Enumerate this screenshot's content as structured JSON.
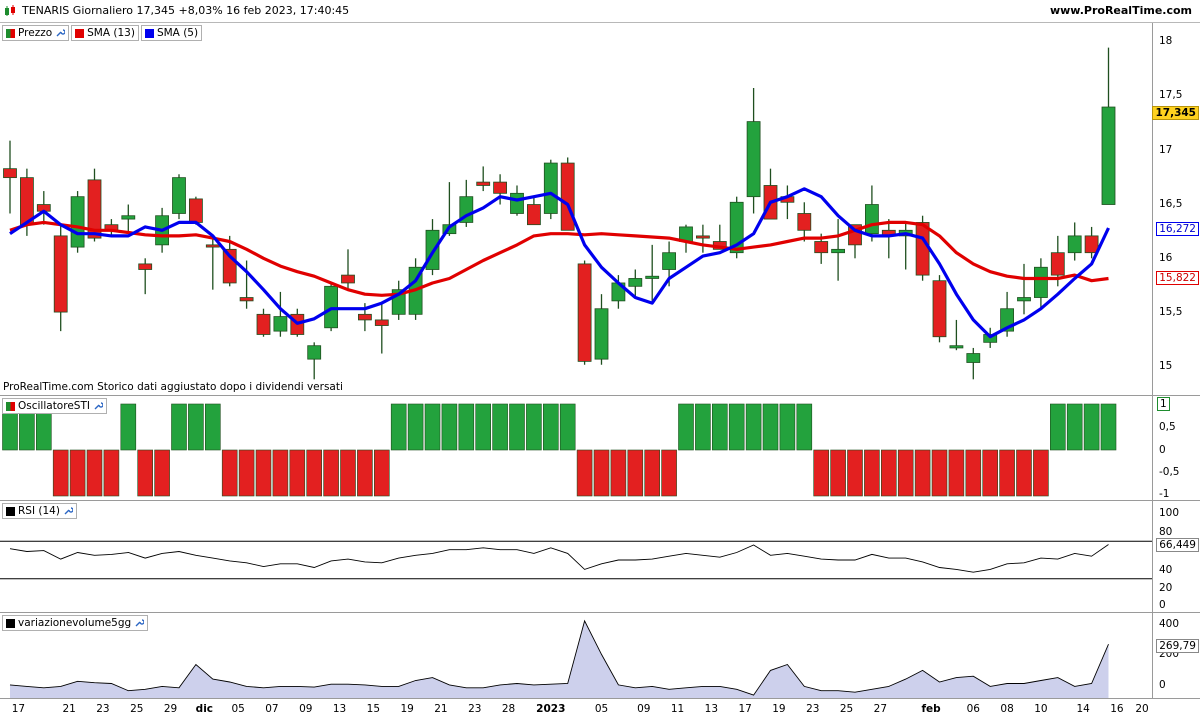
{
  "header": {
    "title": "TENARIS Giornaliero 17,345 +8,03% 16 feb 2023, 17:40:45",
    "site": "www.ProRealTime.com"
  },
  "price_panel": {
    "legend": [
      {
        "label": "Prezzo",
        "color": "#1e8c2e"
      },
      {
        "label": "SMA (13)",
        "color": "#e00000"
      },
      {
        "label": "SMA (5)",
        "color": "#0000ee"
      }
    ],
    "y_ticks": [
      "18",
      "17,5",
      "17",
      "16,5",
      "16",
      "15,5",
      "15"
    ],
    "last_price_badge": "17,345",
    "sma5_badge": "16,272",
    "sma13_badge": "15,822",
    "footnote": "ProRealTime.com  Storico dati aggiustato dopo i dividendi versati"
  },
  "sti_panel": {
    "legend_label": "OscillatoreSTI",
    "y_ticks": [
      "0,5",
      "0",
      "-0,5",
      "-1"
    ],
    "value_badge": "1"
  },
  "rsi_panel": {
    "legend_label": "RSI (14)",
    "y_ticks": [
      "100",
      "80",
      "40",
      "20",
      "0"
    ],
    "value_badge": "66,449"
  },
  "vol_panel": {
    "legend_label": "variazionevolume5gg",
    "y_ticks": [
      "400",
      "200",
      "0"
    ],
    "value_badge": "269,79"
  },
  "x_labels": [
    "17",
    "21",
    "23",
    "25",
    "29",
    "dic",
    "05",
    "07",
    "09",
    "13",
    "15",
    "19",
    "21",
    "23",
    "28",
    "2023",
    "05",
    "09",
    "11",
    "13",
    "17",
    "19",
    "23",
    "25",
    "27",
    "feb",
    "06",
    "08",
    "10",
    "14",
    "16",
    "20"
  ],
  "chart_data": {
    "type": "candlestick",
    "title": "TENARIS Giornaliero",
    "ohlc": [
      {
        "o": 16.8,
        "h": 17.05,
        "l": 16.4,
        "c": 16.72
      },
      {
        "o": 16.72,
        "h": 16.8,
        "l": 16.2,
        "c": 16.3
      },
      {
        "o": 16.48,
        "h": 16.6,
        "l": 16.3,
        "c": 16.42
      },
      {
        "o": 16.2,
        "h": 16.3,
        "l": 15.35,
        "c": 15.52
      },
      {
        "o": 16.1,
        "h": 16.6,
        "l": 16.05,
        "c": 16.55
      },
      {
        "o": 16.7,
        "h": 16.8,
        "l": 16.15,
        "c": 16.18
      },
      {
        "o": 16.3,
        "h": 16.35,
        "l": 16.2,
        "c": 16.25
      },
      {
        "o": 16.35,
        "h": 16.48,
        "l": 16.22,
        "c": 16.38
      },
      {
        "o": 15.95,
        "h": 16.0,
        "l": 15.68,
        "c": 15.9
      },
      {
        "o": 16.12,
        "h": 16.45,
        "l": 16.05,
        "c": 16.38
      },
      {
        "o": 16.4,
        "h": 16.75,
        "l": 16.35,
        "c": 16.72
      },
      {
        "o": 16.53,
        "h": 16.55,
        "l": 16.3,
        "c": 16.32
      },
      {
        "o": 16.12,
        "h": 16.2,
        "l": 15.72,
        "c": 16.1
      },
      {
        "o": 16.08,
        "h": 16.2,
        "l": 15.75,
        "c": 15.78
      },
      {
        "o": 15.65,
        "h": 15.98,
        "l": 15.55,
        "c": 15.62
      },
      {
        "o": 15.5,
        "h": 15.55,
        "l": 15.3,
        "c": 15.32
      },
      {
        "o": 15.35,
        "h": 15.7,
        "l": 15.3,
        "c": 15.48
      },
      {
        "o": 15.5,
        "h": 15.55,
        "l": 15.3,
        "c": 15.32
      },
      {
        "o": 15.1,
        "h": 15.25,
        "l": 14.92,
        "c": 15.22
      },
      {
        "o": 15.38,
        "h": 15.78,
        "l": 15.35,
        "c": 15.75
      },
      {
        "o": 15.85,
        "h": 16.08,
        "l": 15.72,
        "c": 15.78
      },
      {
        "o": 15.5,
        "h": 15.6,
        "l": 15.35,
        "c": 15.45
      },
      {
        "o": 15.45,
        "h": 15.6,
        "l": 15.15,
        "c": 15.4
      },
      {
        "o": 15.5,
        "h": 15.8,
        "l": 15.45,
        "c": 15.72
      },
      {
        "o": 15.5,
        "h": 16.0,
        "l": 15.45,
        "c": 15.92
      },
      {
        "o": 15.9,
        "h": 16.35,
        "l": 15.85,
        "c": 16.25
      },
      {
        "o": 16.22,
        "h": 16.68,
        "l": 16.2,
        "c": 16.3
      },
      {
        "o": 16.32,
        "h": 16.7,
        "l": 16.28,
        "c": 16.55
      },
      {
        "o": 16.68,
        "h": 16.82,
        "l": 16.6,
        "c": 16.65
      },
      {
        "o": 16.68,
        "h": 16.75,
        "l": 16.48,
        "c": 16.58
      },
      {
        "o": 16.4,
        "h": 16.65,
        "l": 16.38,
        "c": 16.58
      },
      {
        "o": 16.48,
        "h": 16.55,
        "l": 16.3,
        "c": 16.3
      },
      {
        "o": 16.4,
        "h": 16.88,
        "l": 16.35,
        "c": 16.85
      },
      {
        "o": 16.85,
        "h": 16.9,
        "l": 16.25,
        "c": 16.25
      },
      {
        "o": 15.95,
        "h": 15.98,
        "l": 15.05,
        "c": 15.08
      },
      {
        "o": 15.1,
        "h": 15.68,
        "l": 15.05,
        "c": 15.55
      },
      {
        "o": 15.62,
        "h": 15.85,
        "l": 15.55,
        "c": 15.78
      },
      {
        "o": 15.75,
        "h": 15.9,
        "l": 15.65,
        "c": 15.82
      },
      {
        "o": 15.82,
        "h": 16.12,
        "l": 15.62,
        "c": 15.84
      },
      {
        "o": 15.9,
        "h": 16.15,
        "l": 15.75,
        "c": 16.05
      },
      {
        "o": 16.15,
        "h": 16.3,
        "l": 16.05,
        "c": 16.28
      },
      {
        "o": 16.2,
        "h": 16.3,
        "l": 16.05,
        "c": 16.18
      },
      {
        "o": 16.15,
        "h": 16.3,
        "l": 16.08,
        "c": 16.08
      },
      {
        "o": 16.05,
        "h": 16.55,
        "l": 16.0,
        "c": 16.5
      },
      {
        "o": 16.55,
        "h": 17.52,
        "l": 16.4,
        "c": 17.22
      },
      {
        "o": 16.65,
        "h": 16.8,
        "l": 16.35,
        "c": 16.35
      },
      {
        "o": 16.55,
        "h": 16.65,
        "l": 16.35,
        "c": 16.5
      },
      {
        "o": 16.4,
        "h": 16.5,
        "l": 16.15,
        "c": 16.25
      },
      {
        "o": 16.15,
        "h": 16.22,
        "l": 15.95,
        "c": 16.05
      },
      {
        "o": 16.05,
        "h": 16.35,
        "l": 15.8,
        "c": 16.08
      },
      {
        "o": 16.3,
        "h": 16.3,
        "l": 16.0,
        "c": 16.12
      },
      {
        "o": 16.22,
        "h": 16.65,
        "l": 16.15,
        "c": 16.48
      },
      {
        "o": 16.25,
        "h": 16.35,
        "l": 16.0,
        "c": 16.2
      },
      {
        "o": 16.2,
        "h": 16.32,
        "l": 15.9,
        "c": 16.25
      },
      {
        "o": 16.32,
        "h": 16.38,
        "l": 15.8,
        "c": 15.85
      },
      {
        "o": 15.8,
        "h": 15.85,
        "l": 15.25,
        "c": 15.3
      },
      {
        "o": 15.2,
        "h": 15.45,
        "l": 15.18,
        "c": 15.22
      },
      {
        "o": 15.07,
        "h": 15.2,
        "l": 14.92,
        "c": 15.15
      },
      {
        "o": 15.25,
        "h": 15.38,
        "l": 15.2,
        "c": 15.32
      },
      {
        "o": 15.35,
        "h": 15.7,
        "l": 15.3,
        "c": 15.55
      },
      {
        "o": 15.62,
        "h": 15.95,
        "l": 15.5,
        "c": 15.65
      },
      {
        "o": 15.65,
        "h": 16.0,
        "l": 15.55,
        "c": 15.92
      },
      {
        "o": 16.05,
        "h": 16.2,
        "l": 15.75,
        "c": 15.85
      },
      {
        "o": 16.05,
        "h": 16.32,
        "l": 15.98,
        "c": 16.2
      },
      {
        "o": 16.2,
        "h": 16.28,
        "l": 16.0,
        "c": 16.05
      },
      {
        "o": 16.48,
        "h": 17.88,
        "l": 16.48,
        "c": 17.35
      }
    ],
    "sma5": [
      16.22,
      16.32,
      16.42,
      16.3,
      16.22,
      16.22,
      16.2,
      16.2,
      16.28,
      16.25,
      16.32,
      16.32,
      16.2,
      16.02,
      15.88,
      15.72,
      15.55,
      15.42,
      15.46,
      15.55,
      15.55,
      15.55,
      15.6,
      15.68,
      15.8,
      16.05,
      16.28,
      16.38,
      16.45,
      16.55,
      16.52,
      16.55,
      16.58,
      16.48,
      16.12,
      15.92,
      15.78,
      15.65,
      15.6,
      15.82,
      15.92,
      16.02,
      16.05,
      16.12,
      16.22,
      16.5,
      16.55,
      16.62,
      16.55,
      16.38,
      16.25,
      16.2,
      16.2,
      16.22,
      16.18,
      15.95,
      15.68,
      15.45,
      15.3,
      15.38,
      15.45,
      15.55,
      15.68,
      15.82,
      15.95,
      16.27
    ],
    "sma13": [
      16.25,
      16.3,
      16.32,
      16.3,
      16.28,
      16.25,
      16.25,
      16.23,
      16.21,
      16.2,
      16.2,
      16.21,
      16.18,
      16.15,
      16.08,
      16.0,
      15.93,
      15.88,
      15.84,
      15.78,
      15.72,
      15.68,
      15.67,
      15.68,
      15.72,
      15.78,
      15.82,
      15.9,
      15.98,
      16.05,
      16.12,
      16.2,
      16.22,
      16.22,
      16.21,
      16.22,
      16.21,
      16.2,
      16.19,
      16.18,
      16.15,
      16.12,
      16.1,
      16.08,
      16.1,
      16.12,
      16.15,
      16.18,
      16.18,
      16.2,
      16.25,
      16.3,
      16.32,
      16.32,
      16.3,
      16.2,
      16.05,
      15.95,
      15.88,
      15.84,
      15.82,
      15.82,
      15.82,
      15.85,
      15.8,
      15.82
    ],
    "sti": [
      1,
      1,
      1,
      -1,
      -1,
      -1,
      -1,
      1,
      -1,
      -1,
      1,
      1,
      1,
      -1,
      -1,
      -1,
      -1,
      -1,
      -1,
      -1,
      -1,
      -1,
      -1,
      1,
      1,
      1,
      1,
      1,
      1,
      1,
      1,
      1,
      1,
      1,
      -1,
      -1,
      -1,
      -1,
      -1,
      -1,
      1,
      1,
      1,
      1,
      1,
      1,
      1,
      1,
      -1,
      -1,
      -1,
      -1,
      -1,
      -1,
      -1,
      -1,
      -1,
      -1,
      -1,
      -1,
      -1,
      -1,
      1,
      1,
      1,
      1
    ],
    "rsi": [
      62,
      59,
      60,
      51,
      58,
      55,
      56,
      58,
      52,
      57,
      59,
      55,
      52,
      49,
      47,
      43,
      46,
      46,
      42,
      49,
      51,
      48,
      47,
      52,
      55,
      57,
      61,
      61,
      63,
      61,
      61,
      57,
      63,
      57,
      40,
      46,
      50,
      50,
      51,
      54,
      57,
      55,
      53,
      58,
      66,
      55,
      57,
      54,
      51,
      50,
      50,
      56,
      52,
      52,
      48,
      42,
      40,
      37,
      40,
      46,
      47,
      52,
      51,
      57,
      54,
      66.449
    ],
    "rsi_ylim": [
      0,
      100
    ],
    "rsi_levels": [
      30,
      70
    ],
    "volvar": [
      -10,
      -20,
      -30,
      -20,
      15,
      5,
      0,
      -50,
      -40,
      -20,
      -30,
      130,
      30,
      10,
      -20,
      -30,
      -20,
      -20,
      -25,
      -5,
      -5,
      -10,
      -20,
      -20,
      20,
      40,
      -10,
      -30,
      -30,
      -10,
      0,
      -10,
      -5,
      0,
      430,
      200,
      -10,
      -30,
      -20,
      -40,
      -30,
      -20,
      -20,
      -40,
      -80,
      90,
      130,
      -20,
      -50,
      -50,
      -60,
      -40,
      -20,
      30,
      90,
      10,
      40,
      50,
      -20,
      0,
      0,
      20,
      40,
      -20,
      0,
      269.79
    ],
    "volvar_ylim": [
      -100,
      450
    ],
    "price_ylim": [
      14.78,
      18.1
    ],
    "x_label_index": [
      0.5,
      3.5,
      5.5,
      7.5,
      9.5,
      11.5,
      13.5,
      15.5,
      17.5,
      19.5,
      21.5,
      23.5,
      25.5,
      27.5,
      29.5,
      32.0,
      35.0,
      37.5,
      39.5,
      41.5,
      43.5,
      45.5,
      47.5,
      49.5,
      51.5,
      54.5,
      57.0,
      59.0,
      61.0,
      63.5,
      65.5,
      67.5
    ]
  }
}
